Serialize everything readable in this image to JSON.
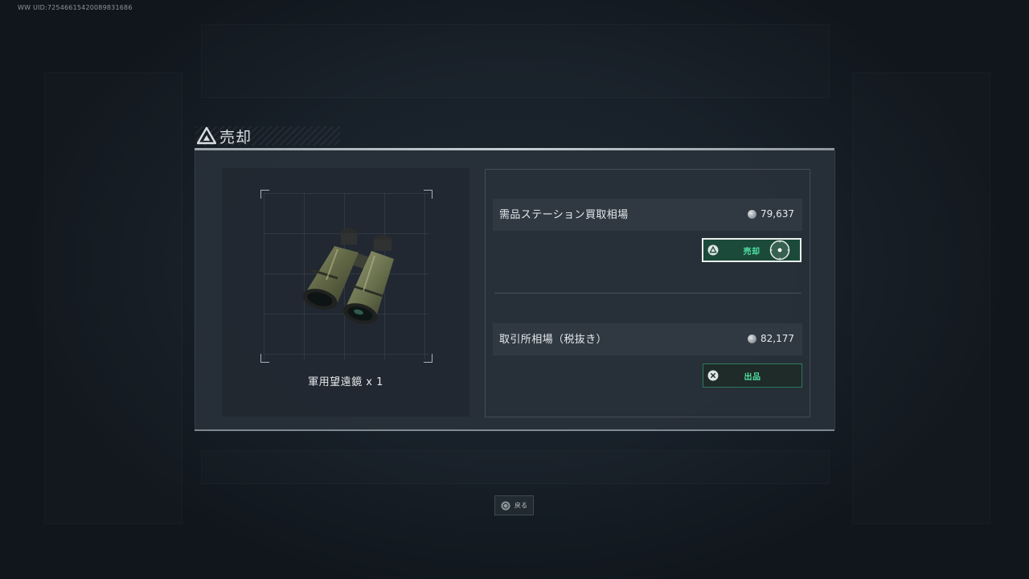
{
  "uid_text": "WW UID:72546615420089831686",
  "dialog": {
    "title": "売却",
    "title_icon": "triangle-warning-icon"
  },
  "item": {
    "name": "軍用望遠鏡 x 1",
    "icon": "binoculars-icon"
  },
  "prices": {
    "station": {
      "label": "需品ステーション買取相場",
      "value": "79,637",
      "currency_icon": "coin-icon"
    },
    "exchange": {
      "label": "取引所相場（税抜き）",
      "value": "82,177",
      "currency_icon": "coin-icon"
    }
  },
  "buttons": {
    "sell": {
      "label": "売却",
      "glyph": "triangle-button-icon",
      "selected": true
    },
    "list": {
      "label": "出品",
      "glyph": "cross-button-icon",
      "selected": false
    },
    "back": {
      "label": "戻る",
      "glyph": "circle-button-icon"
    }
  },
  "colors": {
    "accent_green": "#4fe0a2",
    "sell_button_bg": "#1c4a3a",
    "panel_bg": "#29313a",
    "background": "#151c24"
  }
}
